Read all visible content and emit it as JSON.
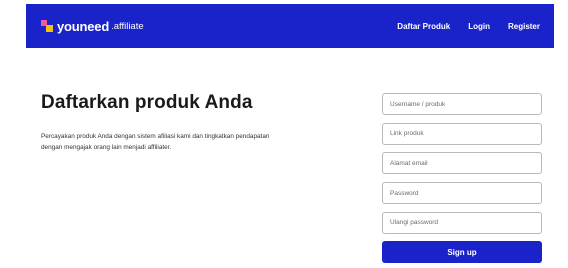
{
  "nav": {
    "brand": "youneed",
    "brand_suffix": ".affiliate",
    "links": [
      "Daftar Produk",
      "Login",
      "Register"
    ]
  },
  "hero": {
    "title": "Daftarkan produk Anda",
    "description": "Percayakan produk Anda dengan sistem afiliasi kami dan tingkatkan pendapatan dengan mengajak orang lain menjadi affiliater."
  },
  "form": {
    "fields": [
      {
        "placeholder": "Username / produk"
      },
      {
        "placeholder": "Link produk"
      },
      {
        "placeholder": "Alamat email"
      },
      {
        "placeholder": "Password"
      },
      {
        "placeholder": "Ulangi password"
      }
    ],
    "submit_label": "Sign up"
  },
  "colors": {
    "primary": "#1a23c9",
    "logo_pink": "#f05a9d",
    "logo_yellow": "#f4c20d"
  }
}
